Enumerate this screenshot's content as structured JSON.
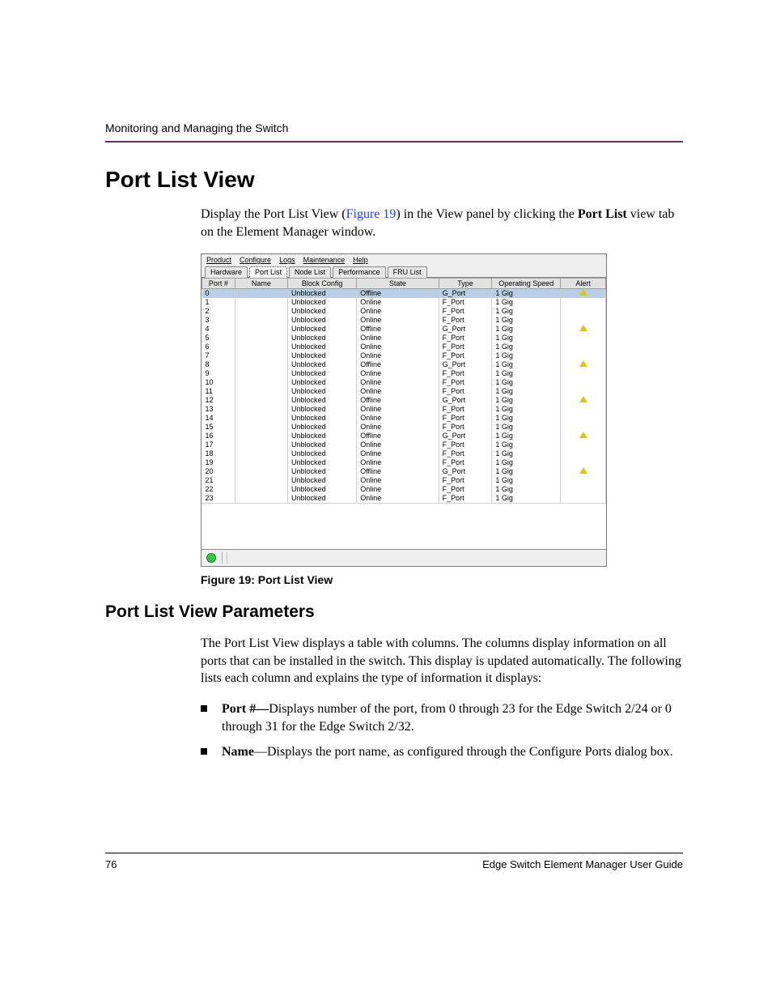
{
  "header": {
    "running_head": "Monitoring and Managing the Switch"
  },
  "section": {
    "title": "Port List View",
    "intro_pre": "Display the Port List View (",
    "intro_link": "Figure 19",
    "intro_mid": ") in the View panel by clicking the ",
    "intro_bold": "Port List",
    "intro_post": " view tab on the Element Manager window."
  },
  "app": {
    "menus": [
      "Product",
      "Configure",
      "Logs",
      "Maintenance",
      "Help"
    ],
    "tabs": [
      "Hardware",
      "Port List",
      "Node List",
      "Performance",
      "FRU List"
    ],
    "active_tab_index": 1,
    "columns": [
      "Port #",
      "Name",
      "Block Config",
      "State",
      "Type",
      "Operating Speed",
      "Alert"
    ],
    "rows": [
      {
        "port": "0",
        "name": "",
        "block": "Unblocked",
        "state": "Offline",
        "type": "G_Port",
        "speed": "1 Gig",
        "alert": true,
        "selected": true
      },
      {
        "port": "1",
        "name": "",
        "block": "Unblocked",
        "state": "Online",
        "type": "F_Port",
        "speed": "1 Gig",
        "alert": false
      },
      {
        "port": "2",
        "name": "",
        "block": "Unblocked",
        "state": "Online",
        "type": "F_Port",
        "speed": "1 Gig",
        "alert": false
      },
      {
        "port": "3",
        "name": "",
        "block": "Unblocked",
        "state": "Online",
        "type": "F_Port",
        "speed": "1 Gig",
        "alert": false
      },
      {
        "port": "4",
        "name": "",
        "block": "Unblocked",
        "state": "Offline",
        "type": "G_Port",
        "speed": "1 Gig",
        "alert": true
      },
      {
        "port": "5",
        "name": "",
        "block": "Unblocked",
        "state": "Online",
        "type": "F_Port",
        "speed": "1 Gig",
        "alert": false
      },
      {
        "port": "6",
        "name": "",
        "block": "Unblocked",
        "state": "Online",
        "type": "F_Port",
        "speed": "1 Gig",
        "alert": false
      },
      {
        "port": "7",
        "name": "",
        "block": "Unblocked",
        "state": "Online",
        "type": "F_Port",
        "speed": "1 Gig",
        "alert": false
      },
      {
        "port": "8",
        "name": "",
        "block": "Unblocked",
        "state": "Offline",
        "type": "G_Port",
        "speed": "1 Gig",
        "alert": true
      },
      {
        "port": "9",
        "name": "",
        "block": "Unblocked",
        "state": "Online",
        "type": "F_Port",
        "speed": "1 Gig",
        "alert": false
      },
      {
        "port": "10",
        "name": "",
        "block": "Unblocked",
        "state": "Online",
        "type": "F_Port",
        "speed": "1 Gig",
        "alert": false
      },
      {
        "port": "11",
        "name": "",
        "block": "Unblocked",
        "state": "Online",
        "type": "F_Port",
        "speed": "1 Gig",
        "alert": false
      },
      {
        "port": "12",
        "name": "",
        "block": "Unblocked",
        "state": "Offline",
        "type": "G_Port",
        "speed": "1 Gig",
        "alert": true
      },
      {
        "port": "13",
        "name": "",
        "block": "Unblocked",
        "state": "Online",
        "type": "F_Port",
        "speed": "1 Gig",
        "alert": false
      },
      {
        "port": "14",
        "name": "",
        "block": "Unblocked",
        "state": "Online",
        "type": "F_Port",
        "speed": "1 Gig",
        "alert": false
      },
      {
        "port": "15",
        "name": "",
        "block": "Unblocked",
        "state": "Online",
        "type": "F_Port",
        "speed": "1 Gig",
        "alert": false
      },
      {
        "port": "16",
        "name": "",
        "block": "Unblocked",
        "state": "Offline",
        "type": "G_Port",
        "speed": "1 Gig",
        "alert": true
      },
      {
        "port": "17",
        "name": "",
        "block": "Unblocked",
        "state": "Online",
        "type": "F_Port",
        "speed": "1 Gig",
        "alert": false
      },
      {
        "port": "18",
        "name": "",
        "block": "Unblocked",
        "state": "Online",
        "type": "F_Port",
        "speed": "1 Gig",
        "alert": false
      },
      {
        "port": "19",
        "name": "",
        "block": "Unblocked",
        "state": "Online",
        "type": "F_Port",
        "speed": "1 Gig",
        "alert": false
      },
      {
        "port": "20",
        "name": "",
        "block": "Unblocked",
        "state": "Offline",
        "type": "G_Port",
        "speed": "1 Gig",
        "alert": true
      },
      {
        "port": "21",
        "name": "",
        "block": "Unblocked",
        "state": "Online",
        "type": "F_Port",
        "speed": "1 Gig",
        "alert": false
      },
      {
        "port": "22",
        "name": "",
        "block": "Unblocked",
        "state": "Online",
        "type": "F_Port",
        "speed": "1 Gig",
        "alert": false
      },
      {
        "port": "23",
        "name": "",
        "block": "Unblocked",
        "state": "Online",
        "type": "F_Port",
        "speed": "1 Gig",
        "alert": false
      }
    ]
  },
  "figure_caption": "Figure 19:  Port List View",
  "subsection": {
    "title": "Port List View Parameters",
    "intro": "The Port List View displays a table with columns. The columns display information on all ports that can be installed in the switch. This display is updated automatically. The following lists each column and explains the type of information it displays:",
    "bullets": [
      {
        "term": "Port #—",
        "desc": "Displays number of the port, from 0 through 23 for the Edge Switch 2/24 or 0 through 31 for the Edge Switch 2/32."
      },
      {
        "term": "Name",
        "sep": "—",
        "desc": "Displays the port name, as configured through the Configure Ports dialog box."
      }
    ]
  },
  "footer": {
    "page_num": "76",
    "doc_title": "Edge Switch Element Manager User Guide"
  }
}
